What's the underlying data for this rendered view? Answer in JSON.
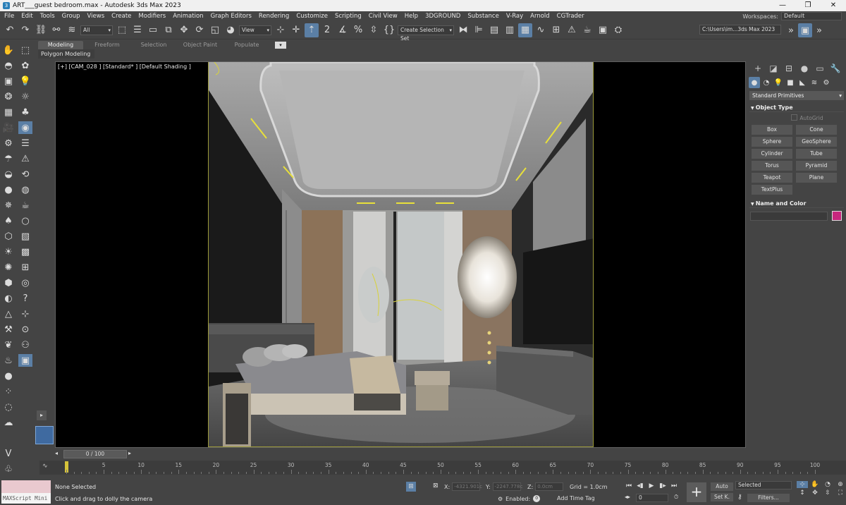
{
  "window": {
    "title": "ART___guest bedroom.max - Autodesk 3ds Max 2023",
    "minimize": "—",
    "restore": "❐",
    "close": "✕"
  },
  "menu": {
    "items": [
      "File",
      "Edit",
      "Tools",
      "Group",
      "Views",
      "Create",
      "Modifiers",
      "Animation",
      "Graph Editors",
      "Rendering",
      "Customize",
      "Scripting",
      "Civil View",
      "Help",
      "3DGROUND",
      "Substance",
      "V-Ray",
      "Arnold",
      "CGTrader"
    ],
    "workspaces_label": "Workspaces:",
    "workspaces_value": "Default"
  },
  "toolbar": {
    "filter_value": "All",
    "refcoord_value": "View",
    "create_selection_set": "Create Selection Set",
    "project_path": "C:\\Users\\im...3ds Max 2023"
  },
  "ribbon": {
    "tabs": [
      "Modeling",
      "Freeform",
      "Selection",
      "Object Paint",
      "Populate"
    ],
    "sub_label": "Polygon Modeling"
  },
  "viewport": {
    "label": "[+] [CAM_028 ] [Standard* ] [Default Shading ]"
  },
  "command_panel": {
    "category": "Standard Primitives",
    "object_type_header": "Object Type",
    "autogrid_label": "AutoGrid",
    "object_buttons": [
      "Box",
      "Cone",
      "Sphere",
      "GeoSphere",
      "Cylinder",
      "Tube",
      "Torus",
      "Pyramid",
      "Teapot",
      "Plane",
      "TextPlus"
    ],
    "name_color_header": "Name and Color",
    "object_color": "#c8267e"
  },
  "timeline": {
    "frame_display": "0 / 100",
    "ticks": [
      5,
      10,
      15,
      20,
      25,
      30,
      35,
      40,
      45,
      50,
      55,
      60,
      65,
      70,
      75,
      80,
      85,
      90,
      95,
      100
    ],
    "current_frame": 0
  },
  "status": {
    "maxscript_label": "MAXScript Mini",
    "selection_info": "None Selected",
    "prompt": "Click and drag to dolly the camera",
    "x_label": "X:",
    "x_value": "-4321.901c",
    "y_label": "Y:",
    "y_value": "-2247.778c",
    "z_label": "Z:",
    "z_value": "0.0cm",
    "grid": "Grid = 1.0cm",
    "enabled_label": "Enabled:",
    "add_time_tag": "Add Time Tag",
    "frame_value": "0",
    "auto_label": "Auto",
    "setk_label": "Set K.",
    "selected_dropdown": "Selected",
    "filters_label": "Filters..."
  }
}
